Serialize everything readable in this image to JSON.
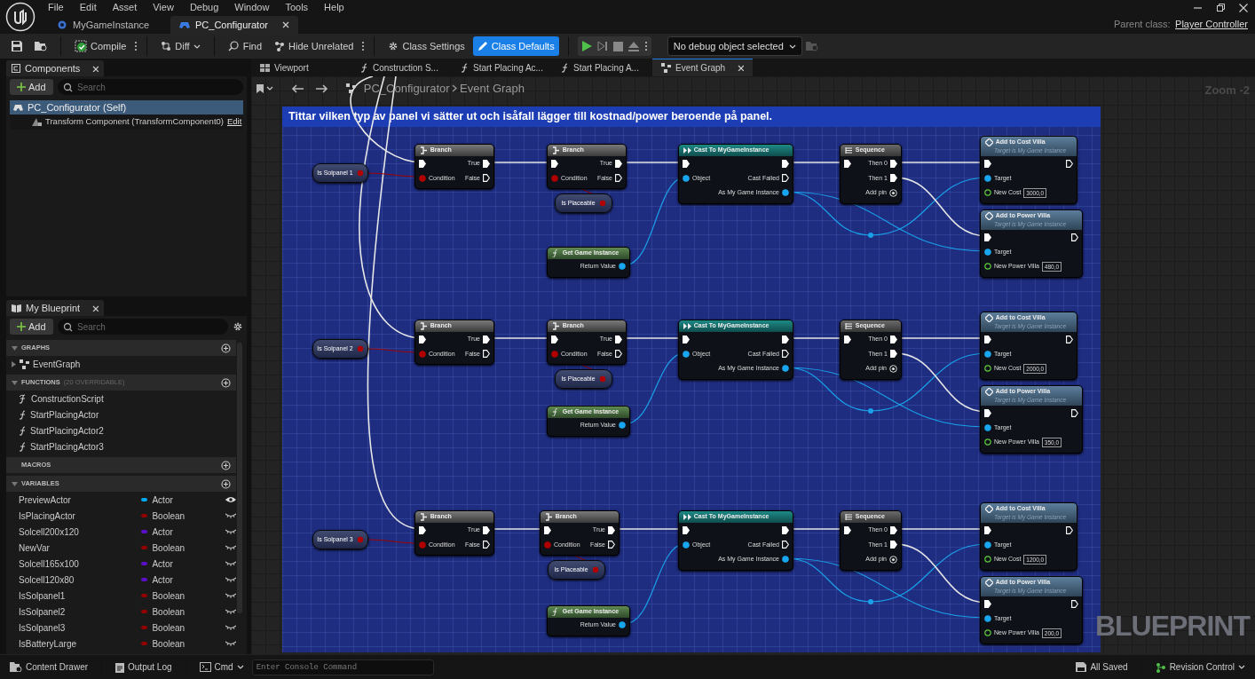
{
  "menu": [
    "File",
    "Edit",
    "Asset",
    "View",
    "Debug",
    "Window",
    "Tools",
    "Help"
  ],
  "doc_tabs": [
    {
      "label": "MyGameInstance",
      "selected": false
    },
    {
      "label": "PC_Configurator",
      "selected": true
    }
  ],
  "parent_class": {
    "label": "Parent class:",
    "value": "Player Controller"
  },
  "toolbar": {
    "compile": "Compile",
    "diff": "Diff",
    "find": "Find",
    "hide_unrelated": "Hide Unrelated",
    "class_settings": {
      "label": "Class Settings",
      "selected": false
    },
    "class_defaults": {
      "label": "Class Defaults",
      "selected": true
    },
    "debug_object": "No debug object selected"
  },
  "components": {
    "tab": "Components",
    "add": "Add",
    "search_placeholder": "Search",
    "tree": [
      {
        "label": "PC_Configurator (Self)",
        "selected": true,
        "children": [
          {
            "label": "Transform Component (TransformComponent0)",
            "selected": false,
            "action": "Edit"
          }
        ]
      }
    ]
  },
  "my_blueprint": {
    "tab": "My Blueprint",
    "add": "Add",
    "search_placeholder": "Search",
    "sections": [
      {
        "title": "GRAPHS",
        "expanded": true,
        "items": [
          {
            "label": "EventGraph",
            "kind": "graph"
          }
        ]
      },
      {
        "title": "FUNCTIONS",
        "note": "(20 OVERRIDABLE)",
        "expanded": true,
        "items": [
          {
            "label": "ConstructionScript",
            "kind": "construction"
          },
          {
            "label": "StartPlacingActor",
            "kind": "function"
          },
          {
            "label": "StartPlacingActor2",
            "kind": "function"
          },
          {
            "label": "StartPlacingActor3",
            "kind": "function"
          }
        ]
      },
      {
        "title": "MACROS"
      },
      {
        "title": "VARIABLES",
        "expanded": true,
        "variables": [
          {
            "name": "PreviewActor",
            "type": "Actor",
            "color": "#00a8f0",
            "visible": true
          },
          {
            "name": "IsPlacingActor",
            "type": "Boolean",
            "color": "#930000",
            "visible": false
          },
          {
            "name": "Solcell200x120",
            "type": "Actor",
            "color": "#5a10c8",
            "visible": false
          },
          {
            "name": "NewVar",
            "type": "Boolean",
            "color": "#930000",
            "visible": false
          },
          {
            "name": "Solcell165x100",
            "type": "Actor",
            "color": "#5a10c8",
            "visible": false
          },
          {
            "name": "Solcell120x80",
            "type": "Actor",
            "color": "#5a10c8",
            "visible": false
          },
          {
            "name": "IsSolpanel1",
            "type": "Boolean",
            "color": "#930000",
            "visible": false
          },
          {
            "name": "IsSolpanel2",
            "type": "Boolean",
            "color": "#930000",
            "visible": false
          },
          {
            "name": "IsSolpanel3",
            "type": "Boolean",
            "color": "#930000",
            "visible": false
          },
          {
            "name": "IsBatteryLarge",
            "type": "Boolean",
            "color": "#930000",
            "visible": false
          }
        ]
      }
    ]
  },
  "graph_tabs": [
    {
      "label": "Viewport",
      "kind": "viewport",
      "selected": false
    },
    {
      "label": "Construction S...",
      "kind": "function",
      "selected": false
    },
    {
      "label": "Start Placing Ac...",
      "kind": "function",
      "selected": false
    },
    {
      "label": "Start Placing A...",
      "kind": "function",
      "selected": false
    },
    {
      "label": "Event Graph",
      "kind": "graph",
      "selected": true
    }
  ],
  "breadcrumb": [
    "PC_Configurator",
    "Event Graph"
  ],
  "zoom": "Zoom -2",
  "watermark": "BLUEPRINT",
  "comment": "Tittar vilken typ av panel vi sätter ut och isåfall lägger till kostnad/power beroende på panel.",
  "groups": [
    {
      "nodes": [
        {
          "kind": "variable",
          "title": "Is Solpanel 1"
        },
        {
          "kind": "branch",
          "title": "Branch",
          "rows": [
            {
              "left": {
                "kind": "exec",
                "linked": true
              },
              "right": {
                "kind": "exec",
                "label": "True",
                "linked": true
              }
            },
            {
              "left": {
                "kind": "bool",
                "label": "Condition",
                "linked": true
              },
              "right": {
                "kind": "exec",
                "label": "False",
                "linked": false
              }
            }
          ]
        },
        {
          "kind": "branch",
          "title": "Branch",
          "rows": [
            {
              "left": {
                "kind": "exec",
                "linked": true
              },
              "right": {
                "kind": "exec",
                "label": "True",
                "linked": true
              }
            },
            {
              "left": {
                "kind": "bool",
                "label": "Condition",
                "linked": true
              },
              "right": {
                "kind": "exec",
                "label": "False",
                "linked": false
              }
            }
          ]
        },
        {
          "kind": "variable",
          "title": "Is Placeable"
        },
        {
          "kind": "function",
          "title": "Get Game Instance",
          "rows": [
            {
              "right": {
                "kind": "object",
                "label": "Return Value",
                "linked": true
              }
            }
          ]
        },
        {
          "kind": "cast",
          "title": "Cast To MyGameInstance",
          "rows": [
            {
              "left": {
                "kind": "exec",
                "linked": true
              },
              "right": {
                "kind": "exec",
                "linked": true
              }
            },
            {
              "left": {
                "kind": "object",
                "label": "Object",
                "linked": true
              },
              "right": {
                "kind": "exec",
                "label": "Cast Failed",
                "linked": false
              }
            },
            {
              "right": {
                "kind": "object",
                "label": "As My Game Instance",
                "linked": true
              }
            }
          ]
        },
        {
          "kind": "sequence",
          "title": "Sequence",
          "rows": [
            {
              "left": {
                "kind": "exec",
                "linked": true
              },
              "right": {
                "kind": "exec",
                "label": "Then 0",
                "linked": true
              }
            },
            {
              "right": {
                "kind": "exec",
                "label": "Then 1",
                "linked": true
              }
            },
            {
              "right": {
                "kind": "add",
                "label": "Add pin"
              }
            }
          ]
        },
        {
          "kind": "call",
          "title": "Add to Cost Villa",
          "subtitle": "Target is My Game Instance",
          "rows": [
            {
              "left": {
                "kind": "exec",
                "linked": true
              },
              "right": {
                "kind": "exec",
                "linked": false
              }
            },
            {
              "left": {
                "kind": "object",
                "label": "Target",
                "linked": true
              }
            },
            {
              "left": {
                "kind": "float",
                "label": "New Cost",
                "linked": false,
                "value": "3000,0"
              }
            }
          ]
        },
        {
          "kind": "call",
          "title": "Add to Power Villa",
          "subtitle": "Target is My Game Instance",
          "rows": [
            {
              "left": {
                "kind": "exec",
                "linked": true
              },
              "right": {
                "kind": "exec",
                "linked": false
              }
            },
            {
              "left": {
                "kind": "object",
                "label": "Target",
                "linked": true
              }
            },
            {
              "left": {
                "kind": "float",
                "label": "New Power Villa",
                "linked": false,
                "value": "480,0"
              }
            }
          ]
        }
      ]
    },
    {
      "nodes": [
        {
          "kind": "variable",
          "title": "Is Solpanel 2"
        },
        {
          "kind": "branch",
          "title": "Branch",
          "rows": [
            {
              "left": {
                "kind": "exec",
                "linked": true
              },
              "right": {
                "kind": "exec",
                "label": "True",
                "linked": true
              }
            },
            {
              "left": {
                "kind": "bool",
                "label": "Condition",
                "linked": true
              },
              "right": {
                "kind": "exec",
                "label": "False",
                "linked": false
              }
            }
          ]
        },
        {
          "kind": "branch",
          "title": "Branch",
          "rows": [
            {
              "left": {
                "kind": "exec",
                "linked": true
              },
              "right": {
                "kind": "exec",
                "label": "True",
                "linked": true
              }
            },
            {
              "left": {
                "kind": "bool",
                "label": "Condition",
                "linked": true
              },
              "right": {
                "kind": "exec",
                "label": "False",
                "linked": false
              }
            }
          ]
        },
        {
          "kind": "variable",
          "title": "Is Placeable"
        },
        {
          "kind": "function",
          "title": "Get Game Instance",
          "rows": [
            {
              "right": {
                "kind": "object",
                "label": "Return Value",
                "linked": true
              }
            }
          ]
        },
        {
          "kind": "cast",
          "title": "Cast To MyGameInstance",
          "rows": [
            {
              "left": {
                "kind": "exec",
                "linked": true
              },
              "right": {
                "kind": "exec",
                "linked": true
              }
            },
            {
              "left": {
                "kind": "object",
                "label": "Object",
                "linked": true
              },
              "right": {
                "kind": "exec",
                "label": "Cast Failed",
                "linked": false
              }
            },
            {
              "right": {
                "kind": "object",
                "label": "As My Game Instance",
                "linked": true
              }
            }
          ]
        },
        {
          "kind": "sequence",
          "title": "Sequence",
          "rows": [
            {
              "left": {
                "kind": "exec",
                "linked": true
              },
              "right": {
                "kind": "exec",
                "label": "Then 0",
                "linked": true
              }
            },
            {
              "right": {
                "kind": "exec",
                "label": "Then 1",
                "linked": true
              }
            },
            {
              "right": {
                "kind": "add",
                "label": "Add pin"
              }
            }
          ]
        },
        {
          "kind": "call",
          "title": "Add to Cost Villa",
          "subtitle": "Target is My Game Instance",
          "rows": [
            {
              "left": {
                "kind": "exec",
                "linked": true
              },
              "right": {
                "kind": "exec",
                "linked": false
              }
            },
            {
              "left": {
                "kind": "object",
                "label": "Target",
                "linked": true
              }
            },
            {
              "left": {
                "kind": "float",
                "label": "New Cost",
                "linked": false,
                "value": "2000,0"
              }
            }
          ]
        },
        {
          "kind": "call",
          "title": "Add to Power Villa",
          "subtitle": "Target is My Game Instance",
          "rows": [
            {
              "left": {
                "kind": "exec",
                "linked": true
              },
              "right": {
                "kind": "exec",
                "linked": false
              }
            },
            {
              "left": {
                "kind": "object",
                "label": "Target",
                "linked": true
              }
            },
            {
              "left": {
                "kind": "float",
                "label": "New Power Villa",
                "linked": false,
                "value": "350,0"
              }
            }
          ]
        }
      ]
    },
    {
      "nodes": [
        {
          "kind": "variable",
          "title": "Is Solpanel 3"
        },
        {
          "kind": "branch",
          "title": "Branch",
          "rows": [
            {
              "left": {
                "kind": "exec",
                "linked": true
              },
              "right": {
                "kind": "exec",
                "label": "True",
                "linked": true
              }
            },
            {
              "left": {
                "kind": "bool",
                "label": "Condition",
                "linked": true
              },
              "right": {
                "kind": "exec",
                "label": "False",
                "linked": false
              }
            }
          ]
        },
        {
          "kind": "branch",
          "title": "Branch",
          "rows": [
            {
              "left": {
                "kind": "exec",
                "linked": true
              },
              "right": {
                "kind": "exec",
                "label": "True",
                "linked": true
              }
            },
            {
              "left": {
                "kind": "bool",
                "label": "Condition",
                "linked": true
              },
              "right": {
                "kind": "exec",
                "label": "False",
                "linked": false
              }
            }
          ]
        },
        {
          "kind": "variable",
          "title": "Is Placeable"
        },
        {
          "kind": "function",
          "title": "Get Game Instance",
          "rows": [
            {
              "right": {
                "kind": "object",
                "label": "Return Value",
                "linked": true
              }
            }
          ]
        },
        {
          "kind": "cast",
          "title": "Cast To MyGameInstance",
          "rows": [
            {
              "left": {
                "kind": "exec",
                "linked": true
              },
              "right": {
                "kind": "exec",
                "linked": true
              }
            },
            {
              "left": {
                "kind": "object",
                "label": "Object",
                "linked": true
              },
              "right": {
                "kind": "exec",
                "label": "Cast Failed",
                "linked": false
              }
            },
            {
              "right": {
                "kind": "object",
                "label": "As My Game Instance",
                "linked": true
              }
            }
          ]
        },
        {
          "kind": "sequence",
          "title": "Sequence",
          "rows": [
            {
              "left": {
                "kind": "exec",
                "linked": true
              },
              "right": {
                "kind": "exec",
                "label": "Then 0",
                "linked": true
              }
            },
            {
              "right": {
                "kind": "exec",
                "label": "Then 1",
                "linked": true
              }
            },
            {
              "right": {
                "kind": "add",
                "label": "Add pin"
              }
            }
          ]
        },
        {
          "kind": "call",
          "title": "Add to Cost Villa",
          "subtitle": "Target is My Game Instance",
          "rows": [
            {
              "left": {
                "kind": "exec",
                "linked": true
              },
              "right": {
                "kind": "exec",
                "linked": false
              }
            },
            {
              "left": {
                "kind": "object",
                "label": "Target",
                "linked": true
              }
            },
            {
              "left": {
                "kind": "float",
                "label": "New Cost",
                "linked": false,
                "value": "1200,0"
              }
            }
          ]
        },
        {
          "kind": "call",
          "title": "Add to Power Villa",
          "subtitle": "Target is My Game Instance",
          "rows": [
            {
              "left": {
                "kind": "exec",
                "linked": true
              },
              "right": {
                "kind": "exec",
                "linked": false
              }
            },
            {
              "left": {
                "kind": "object",
                "label": "Target",
                "linked": true
              }
            },
            {
              "left": {
                "kind": "float",
                "label": "New Power Villa",
                "linked": false,
                "value": "200,0"
              }
            }
          ]
        }
      ]
    }
  ],
  "bottom_bar": {
    "content_drawer": "Content Drawer",
    "output_log": "Output Log",
    "cmd": "Cmd",
    "console_placeholder": "Enter Console Command",
    "saved": "All Saved",
    "revision_control": "Revision Control"
  }
}
